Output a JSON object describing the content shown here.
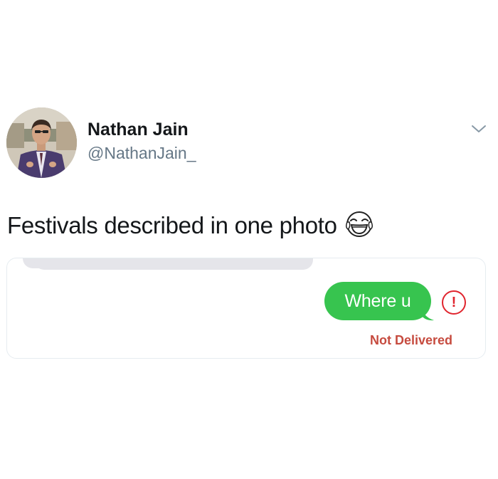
{
  "tweet": {
    "author": {
      "name": "Nathan Jain",
      "handle": "@NathanJain_",
      "avatar": "profile-photo"
    },
    "text": "Festivals described in one photo",
    "emoji": "face-with-tears-of-joy",
    "menu_icon": "chevron-down-icon"
  },
  "media": {
    "message": {
      "text": "Where u",
      "bubble_color": "#37c44f",
      "status": "Not Delivered",
      "status_color": "#c64b3f",
      "error_icon_glyph": "!",
      "error_color": "#e0242d"
    },
    "previous_bubble_color": "#e5e5ea"
  }
}
